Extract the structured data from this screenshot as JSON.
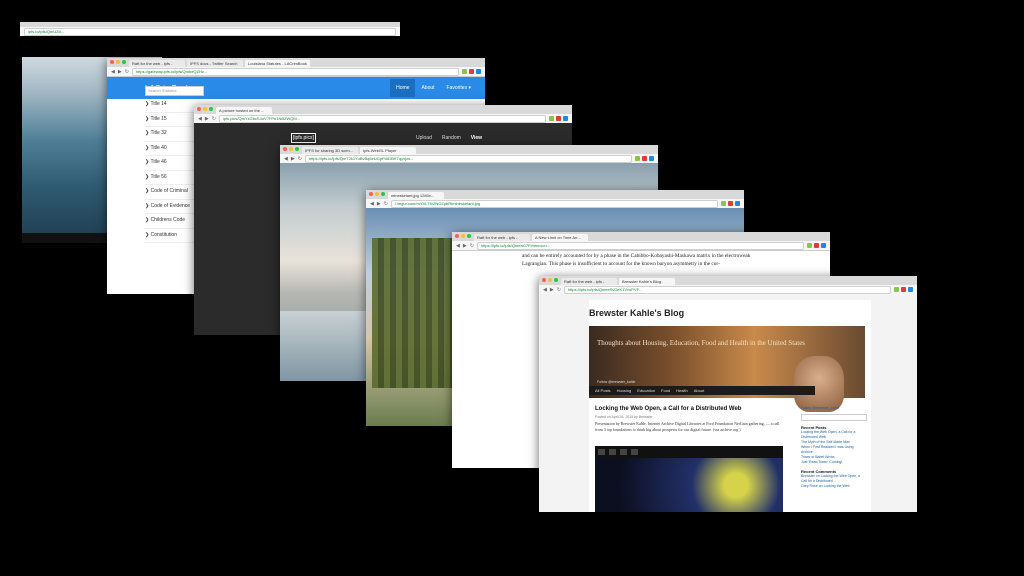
{
  "window_top": {
    "url": "ipfs.io/ipfs/QmUZd..."
  },
  "lacrimbook": {
    "tabs": [
      "Raft for the web - ipfs -",
      "IPFS docs - Twitter Search",
      "Louisiana Statutes - LACrimBook"
    ],
    "url": "https://gateway.ipfs.io/ipfs/QmbeQZHz...",
    "brand": "LACrimBook",
    "nav": [
      "Home",
      "About",
      "Favorites ▾"
    ],
    "search_placeholder": "Search Statutes",
    "items": [
      "Title 14",
      "Title 15",
      "Title 32",
      "Title 40",
      "Title 46",
      "Title 56",
      "Code of Criminal",
      "Code of Evidence",
      "Childrens Code",
      "Constitution"
    ]
  },
  "ipfs_dark": {
    "tabs": [
      "A picture hosted on the ..."
    ],
    "url": "ipfs.pics/QmYkGbcS4oV7FPo1NBZWQM...",
    "logo": "[ipfs.pics]",
    "menu": [
      "Upload",
      "Random",
      "View"
    ]
  },
  "viewer": {
    "tabs": [
      "IPFS for sharing 3D scen...",
      "Ipfs-WebGL Player"
    ],
    "url": "https://ipfs.io/ipfs/QmT2k1YuBvBq6eUGpFtADBKTqyvjzs..."
  },
  "minecraft": {
    "tabs": [
      "mineskelarti.jpg 1280x..."
    ],
    "url": "i.imgur.com/mYXL75/ZNOZpbRtmineskelarti.jpg"
  },
  "doc": {
    "tabs": [
      "Raft for the web - ipfs -",
      "A New Limit on Time Arr..."
    ],
    "url": "https://ipfs.io/ipfs/QmeaG7Fthmmxcu...",
    "text": "and can be entirely accounted for by a phase in the Cabibbo-Kobayashi-Maskawa matrix in the electroweak Lagrangian. This phase is insufficient to account for the known baryon asymmetry in the cor-"
  },
  "blog": {
    "tabs": [
      "Raft for the web - ipfs -",
      "Brewster Kahle's Blog"
    ],
    "url": "https://ipfs.io/ipfs/QmeeSvDeK1VvuPVF...",
    "title": "Brewster Kahle's Blog",
    "tagline": "Thoughts about Housing, Education, Food and Health in the United States",
    "follow": "Follow @brewster_kahle",
    "nav": [
      "All Posts",
      "Housing",
      "Education",
      "Food",
      "Health",
      "About"
    ],
    "post_title": "Locking the Web Open, a Call for a Distributed Web",
    "meta": "Posted on April 26, 2015 by Brewster",
    "body": "Presentation by Brewster Kahle, Internet Archive Digital Libraries at Ford Foundation NetGain gathering, — a call from 3 top foundations to think big about prospects for our digital future. (via archive.org )",
    "side_follow": "Follow @brewster_kahle",
    "recent_posts_heading": "Recent Posts",
    "recent_posts": [
      "Locking the Web Open, a Call for a Distributed Web",
      "The Myth of the Self-Made Man",
      "When I First Realized I was Using Archive...",
      "Tower of Babel Wrote...",
      "Just 'Read Tower' Coming!"
    ],
    "recent_comments_heading": "Recent Comments",
    "recent_comments": [
      "Brewster on Locking the Web Open, a Call for a Distributed...",
      "Gary Rose on Locking the Web"
    ]
  }
}
